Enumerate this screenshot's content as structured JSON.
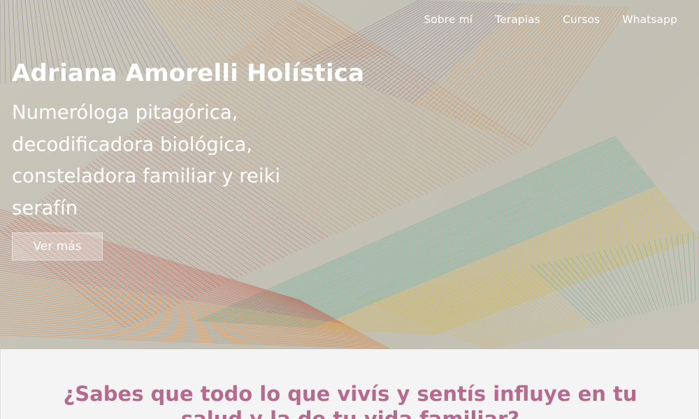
{
  "nav": {
    "items": [
      {
        "label": "Sobre mí"
      },
      {
        "label": "Terapias"
      },
      {
        "label": "Cursos"
      },
      {
        "label": "Whatsapp"
      }
    ]
  },
  "hero": {
    "title": "Adriana Amorelli Holística",
    "subtitle": "Numeróloga pitagórica, decodificadora biológica, consteladora familiar y reiki serafín",
    "cta_label": "Ver más"
  },
  "section": {
    "question": "¿Sabes que todo lo que vivís y sentís influye en tu salud y la de tu vida familiar?"
  },
  "colors": {
    "accent_text": "#b56b8d",
    "hero_bg": "#c4c1b6",
    "line_orange": "#e07a2a",
    "line_red": "#c84b3c",
    "line_green": "#3aa68a",
    "line_yellow": "#d9b52a",
    "line_purple": "#7a5a8c"
  }
}
